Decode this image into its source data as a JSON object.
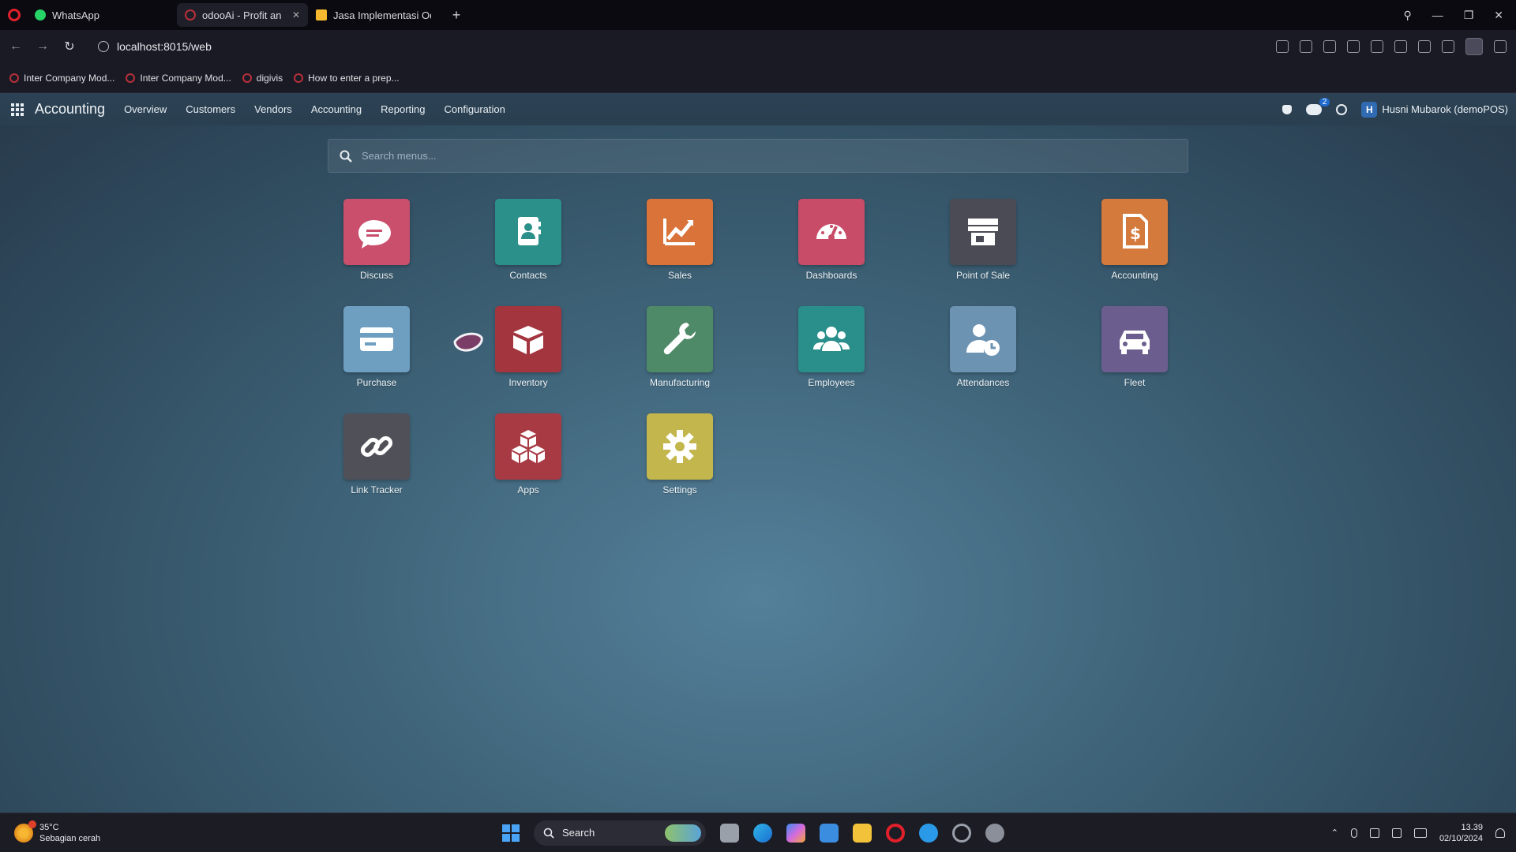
{
  "browser": {
    "tabs": [
      {
        "label": "WhatsApp",
        "icon": "whatsapp-icon",
        "color": "#25d366"
      },
      {
        "label": "odooAi - Profit and Lo",
        "icon": "opera-tab-icon",
        "color": "#b8303a",
        "active": true
      },
      {
        "label": "Jasa Implementasi Odoo I",
        "icon": "page-icon",
        "color": "#f5b82e"
      }
    ],
    "url": "localhost:8015/web",
    "bookmarks": [
      {
        "label": "Inter Company Mod..."
      },
      {
        "label": "Inter Company Mod..."
      },
      {
        "label": "digivis"
      },
      {
        "label": "How to enter a prep..."
      }
    ]
  },
  "odoo": {
    "app_title": "Accounting",
    "menu": [
      "Overview",
      "Customers",
      "Vendors",
      "Accounting",
      "Reporting",
      "Configuration"
    ],
    "chat_count": "2",
    "user": {
      "initial": "H",
      "name": "Husni Mubarok (demoPOS)"
    },
    "search_placeholder": "Search menus...",
    "apps": [
      {
        "label": "Discuss",
        "color": "#c94f6d",
        "icon": "chat-bubble-icon"
      },
      {
        "label": "Contacts",
        "color": "#2b8f8a",
        "icon": "address-book-icon"
      },
      {
        "label": "Sales",
        "color": "#d9733a",
        "icon": "trend-chart-icon"
      },
      {
        "label": "Dashboards",
        "color": "#c84b68",
        "icon": "speedometer-icon"
      },
      {
        "label": "Point of Sale",
        "color": "#4b4b55",
        "icon": "store-icon"
      },
      {
        "label": "Accounting",
        "color": "#d47a3c",
        "icon": "invoice-dollar-icon"
      },
      {
        "label": "Purchase",
        "color": "#6e9fc0",
        "icon": "credit-card-icon"
      },
      {
        "label": "Inventory",
        "color": "#a3353f",
        "icon": "open-box-icon"
      },
      {
        "label": "Manufacturing",
        "color": "#4e8a67",
        "icon": "wrench-icon"
      },
      {
        "label": "Employees",
        "color": "#2a8e8a",
        "icon": "users-icon"
      },
      {
        "label": "Attendances",
        "color": "#6d93b3",
        "icon": "user-clock-icon"
      },
      {
        "label": "Fleet",
        "color": "#6b5e8f",
        "icon": "car-icon"
      },
      {
        "label": "Link Tracker",
        "color": "#505058",
        "icon": "link-icon"
      },
      {
        "label": "Apps",
        "color": "#a83a44",
        "icon": "cubes-icon"
      },
      {
        "label": "Settings",
        "color": "#c2b64c",
        "icon": "gear-icon"
      }
    ]
  },
  "taskbar": {
    "weather_temp": "35°C",
    "weather_desc": "Sebagian cerah",
    "search_label": "Search",
    "time": "13.39",
    "date": "02/10/2024"
  }
}
